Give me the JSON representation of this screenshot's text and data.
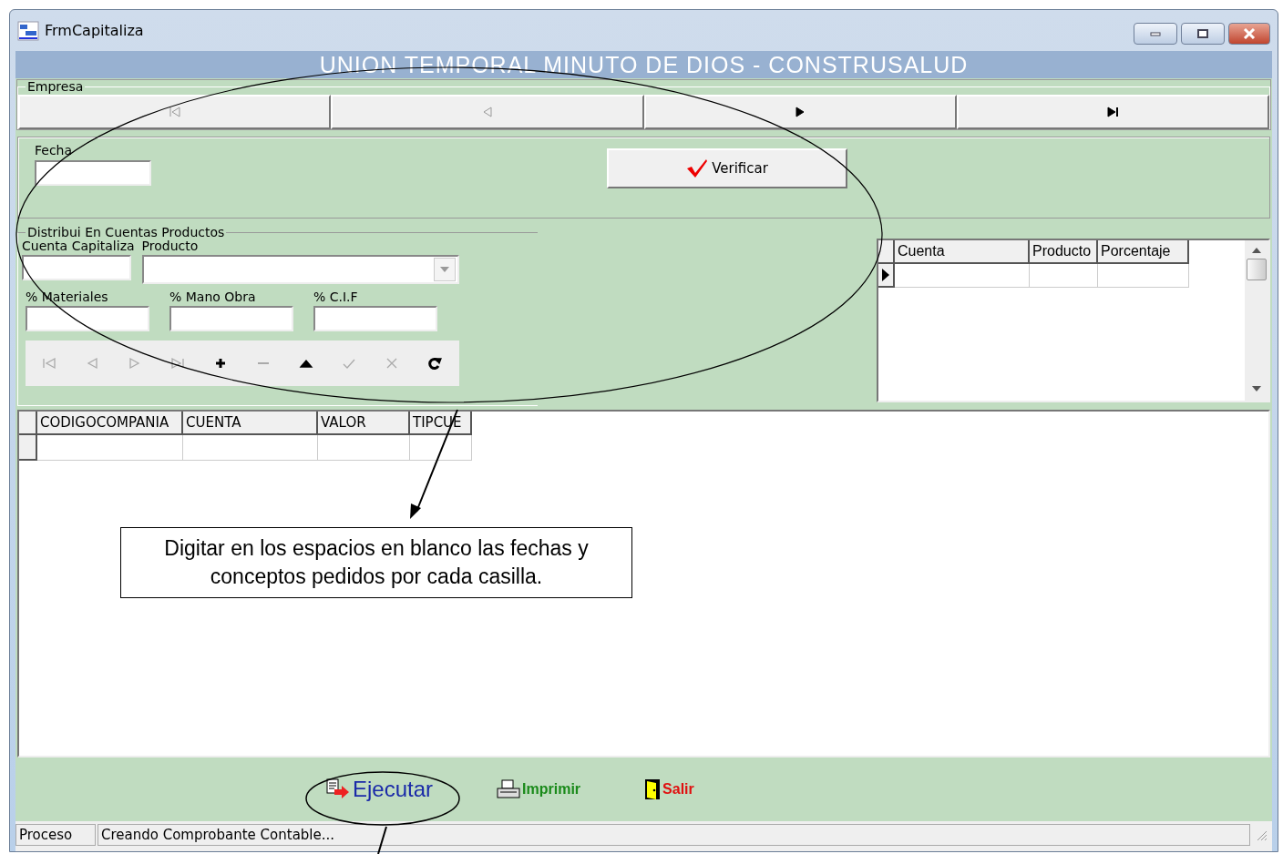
{
  "window": {
    "title": "FrmCapitaliza"
  },
  "banner": "UNION TEMPORAL MINUTO DE DIOS - CONSTRUSALUD",
  "empresa": {
    "label": "Empresa",
    "nav": [
      {
        "kind": "first",
        "disabled": true
      },
      {
        "kind": "prev",
        "disabled": true
      },
      {
        "kind": "next",
        "disabled": false
      },
      {
        "kind": "last",
        "disabled": false
      }
    ]
  },
  "fecha": {
    "label": "Fecha"
  },
  "verify_button": "Verificar",
  "distribucion": {
    "label": "Distribui En Cuentas Productos",
    "cuenta_label": "Cuenta Capitaliza",
    "producto_label": "Producto",
    "percent_fields": [
      "% Materiales",
      "% Mano Obra",
      "% C.I.F"
    ],
    "toolbar": [
      {
        "kind": "first",
        "disabled": true
      },
      {
        "kind": "prev",
        "disabled": true
      },
      {
        "kind": "next",
        "disabled": true
      },
      {
        "kind": "last",
        "disabled": true
      },
      {
        "kind": "add",
        "disabled": false
      },
      {
        "kind": "delete",
        "disabled": true
      },
      {
        "kind": "edit",
        "disabled": false
      },
      {
        "kind": "post",
        "disabled": true
      },
      {
        "kind": "cancel",
        "disabled": true
      },
      {
        "kind": "refresh",
        "disabled": false
      }
    ]
  },
  "cuentas_grid": {
    "columns": [
      "Cuenta",
      "Producto",
      "Porcentaje"
    ],
    "current_row_marker": true
  },
  "main_grid": {
    "columns": [
      "CODIGOCOMPANIA",
      "CUENTA",
      "VALOR",
      "TIPCUE"
    ],
    "current_row_marker": false
  },
  "callout": "Digitar en los espacios en blanco las fechas y conceptos pedidos por cada casilla.",
  "actions": [
    {
      "kind": "execute",
      "label": "Ejecutar"
    },
    {
      "kind": "print",
      "label": "Imprimir"
    },
    {
      "kind": "exit",
      "label": "Salir"
    }
  ],
  "status_bar": [
    "Proceso",
    "Creando Comprobante Contable..."
  ]
}
